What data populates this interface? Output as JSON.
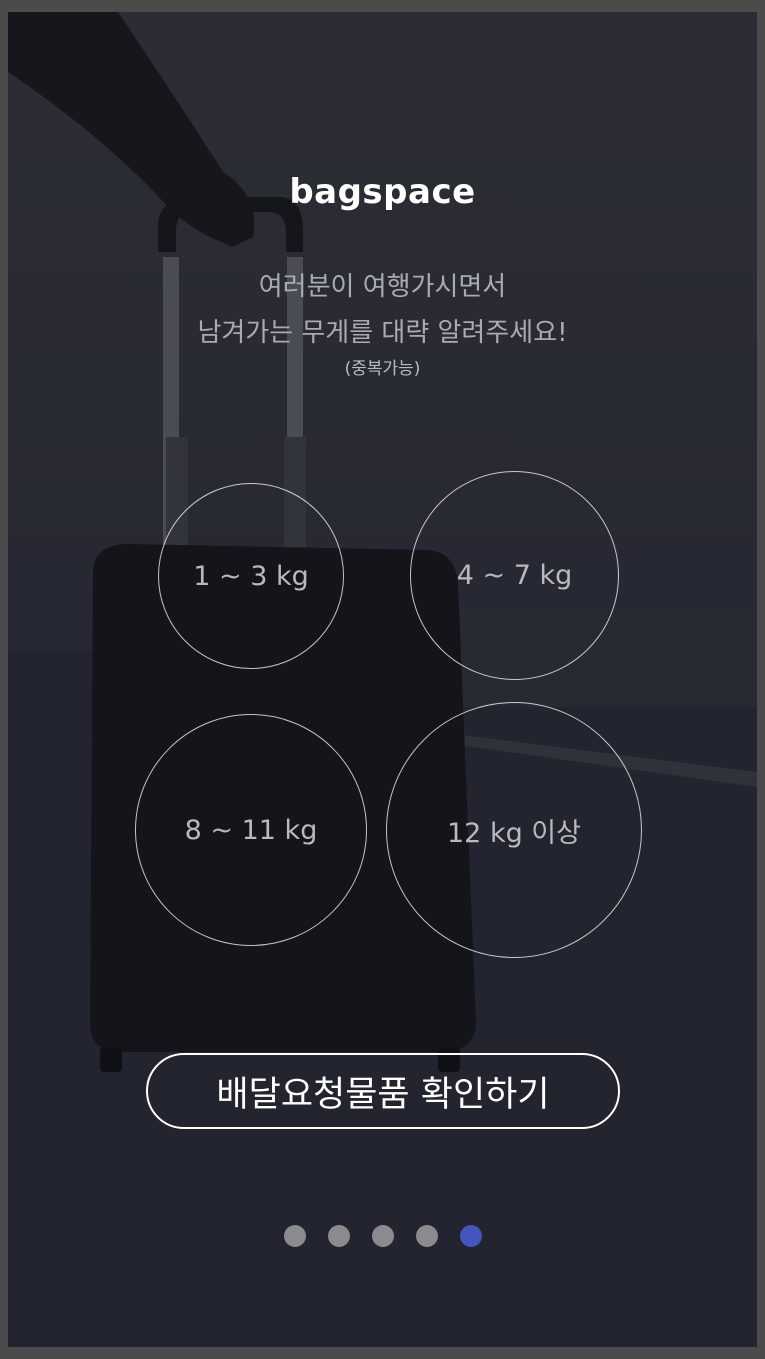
{
  "brand": "bagspace",
  "intro": {
    "line1": "여러분이 여행가시면서",
    "line2": "남겨가는 무게를 대략 알려주세요!",
    "note": "(중복가능)"
  },
  "weight_options": [
    {
      "label": "1 ~ 3 kg"
    },
    {
      "label": "4 ~ 7 kg"
    },
    {
      "label": "8 ~ 11 kg"
    },
    {
      "label": "12 kg 이상"
    }
  ],
  "confirm_button": "배달요청물품 확인하기",
  "pagination": {
    "total": 5,
    "current": 5,
    "inactive_color": "#8a8b8f",
    "active_color": "#4455c0"
  }
}
